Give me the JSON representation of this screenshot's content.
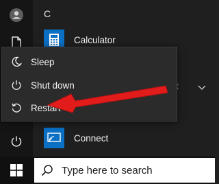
{
  "start_menu": {
    "section_letter": "C",
    "apps": [
      {
        "label": "Calculator",
        "icon": "calculator-icon"
      },
      {
        "label": "Connect",
        "icon": "connect-icon"
      }
    ],
    "partial_text": "t"
  },
  "power_menu": {
    "items": [
      {
        "label": "Sleep",
        "icon": "moon-icon"
      },
      {
        "label": "Shut down",
        "icon": "power-icon"
      },
      {
        "label": "Restart",
        "icon": "restart-icon"
      }
    ]
  },
  "taskbar": {
    "search_placeholder": "Type here to search"
  },
  "colors": {
    "accent": "#0b6fc4",
    "annotation_arrow": "#e21b1b"
  }
}
